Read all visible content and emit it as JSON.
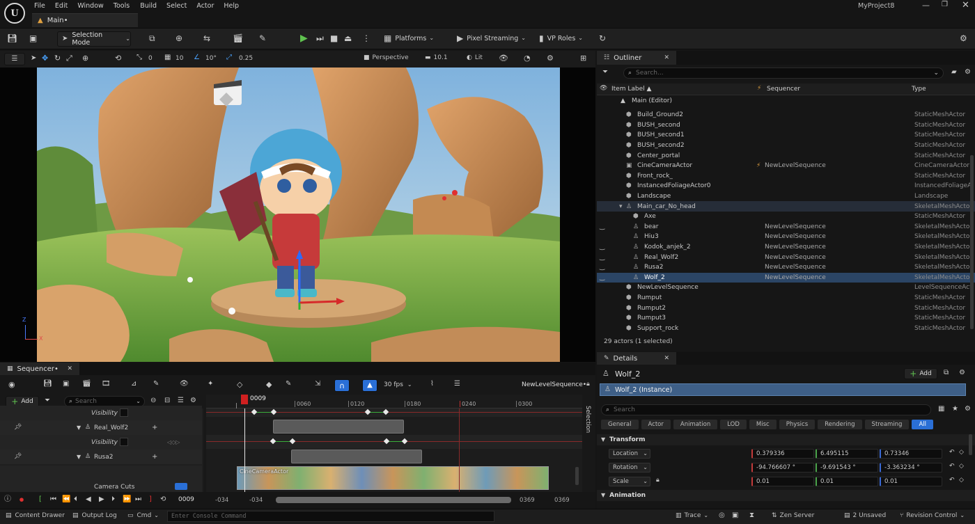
{
  "menubar": {
    "items": [
      "File",
      "Edit",
      "Window",
      "Tools",
      "Build",
      "Select",
      "Actor",
      "Help"
    ],
    "project": "MyProject8",
    "level_tab": "Main•"
  },
  "toolbar": {
    "mode": "Selection Mode",
    "platforms": "Platforms",
    "pixel_streaming": "Pixel Streaming",
    "vp_roles": "VP Roles"
  },
  "viewport_toolbar": {
    "rot_snap": "0",
    "grid": "10",
    "angle": "10°",
    "scale": "0.25",
    "perspective": "Perspective",
    "camera_speed": "10.1",
    "lit": "Lit"
  },
  "axis": {
    "z": "Z",
    "x": "X"
  },
  "outliner": {
    "title": "Outliner",
    "search_placeholder": "Search...",
    "col_label": "Item Label ▲",
    "col_sequencer": "Sequencer",
    "col_type": "Type",
    "root": "Main (Editor)",
    "rows": [
      {
        "label": "Build_Ground2",
        "seq": "",
        "type": "StaticMeshActor",
        "indent": 1,
        "eye": false,
        "sel": false
      },
      {
        "label": "BUSH_second",
        "seq": "",
        "type": "StaticMeshActor",
        "indent": 1,
        "eye": false,
        "sel": false
      },
      {
        "label": "BUSH_second1",
        "seq": "",
        "type": "StaticMeshActor",
        "indent": 1,
        "eye": false,
        "sel": false
      },
      {
        "label": "BUSH_second2",
        "seq": "",
        "type": "StaticMeshActor",
        "indent": 1,
        "eye": false,
        "sel": false
      },
      {
        "label": "Center_portal",
        "seq": "",
        "type": "StaticMeshActor",
        "indent": 1,
        "eye": false,
        "sel": false
      },
      {
        "label": "CineCameraActor",
        "seq": "NewLevelSequence",
        "type": "CineCameraActor",
        "indent": 1,
        "eye": false,
        "sel": false,
        "bolt": true
      },
      {
        "label": "Front_rock_",
        "seq": "",
        "type": "StaticMeshActor",
        "indent": 1,
        "eye": false,
        "sel": false
      },
      {
        "label": "InstancedFoliageActor0",
        "seq": "",
        "type": "InstancedFoliageActor",
        "indent": 1,
        "eye": false,
        "sel": false
      },
      {
        "label": "Landscape",
        "seq": "",
        "type": "Landscape",
        "indent": 1,
        "eye": false,
        "sel": false
      },
      {
        "label": "Main_car_No_head",
        "seq": "",
        "type": "SkeletalMeshActor",
        "indent": 1,
        "eye": false,
        "sel": false,
        "expanded": true,
        "hl": true
      },
      {
        "label": "Axe",
        "seq": "",
        "type": "StaticMeshActor",
        "indent": 2,
        "eye": false,
        "sel": false
      },
      {
        "label": "bear",
        "seq": "NewLevelSequence",
        "type": "SkeletalMeshActor",
        "indent": 2,
        "eye": true,
        "sel": false
      },
      {
        "label": "Hiu3",
        "seq": "NewLevelSequence",
        "type": "SkeletalMeshActor",
        "indent": 2,
        "eye": false,
        "sel": false
      },
      {
        "label": "Kodok_anjek_2",
        "seq": "NewLevelSequence",
        "type": "SkeletalMeshActor",
        "indent": 2,
        "eye": true,
        "sel": false
      },
      {
        "label": "Real_Wolf2",
        "seq": "NewLevelSequence",
        "type": "SkeletalMeshActor",
        "indent": 2,
        "eye": true,
        "sel": false
      },
      {
        "label": "Rusa2",
        "seq": "NewLevelSequence",
        "type": "SkeletalMeshActor",
        "indent": 2,
        "eye": true,
        "sel": false
      },
      {
        "label": "Wolf_2",
        "seq": "NewLevelSequence",
        "type": "SkeletalMeshActor",
        "indent": 2,
        "eye": true,
        "sel": true
      },
      {
        "label": "NewLevelSequence",
        "seq": "",
        "type": "LevelSequenceActor",
        "indent": 1,
        "eye": false,
        "sel": false
      },
      {
        "label": "Rumput",
        "seq": "",
        "type": "StaticMeshActor",
        "indent": 1,
        "eye": false,
        "sel": false
      },
      {
        "label": "Rumput2",
        "seq": "",
        "type": "StaticMeshActor",
        "indent": 1,
        "eye": false,
        "sel": false
      },
      {
        "label": "Rumput3",
        "seq": "",
        "type": "StaticMeshActor",
        "indent": 1,
        "eye": false,
        "sel": false
      },
      {
        "label": "Support_rock",
        "seq": "",
        "type": "StaticMeshActor",
        "indent": 1,
        "eye": false,
        "sel": false
      }
    ],
    "footer": "29 actors (1 selected)"
  },
  "details": {
    "title": "Details",
    "actor": "Wolf_2",
    "add": "Add",
    "instance": "Wolf_2 (Instance)",
    "search_placeholder": "Search",
    "tabs": [
      "General",
      "Actor",
      "Animation",
      "LOD",
      "Misc",
      "Physics",
      "Rendering",
      "Streaming",
      "All"
    ],
    "transform_label": "Transform",
    "location_label": "Location",
    "rotation_label": "Rotation",
    "scale_label": "Scale",
    "location": [
      "0.379336",
      "6.495115",
      "0.73346"
    ],
    "rotation": [
      "-94.766607 °",
      "-9.691543 °",
      "-3.363234 °"
    ],
    "scale": [
      "0.01",
      "0.01",
      "0.01"
    ],
    "animation_label": "Animation"
  },
  "sequencer": {
    "title": "Sequencer•",
    "fps": "30 fps",
    "sequence_name": "NewLevelSequence•",
    "add": "Add",
    "search_placeholder": "Search",
    "current_frame": "0009",
    "ticks": [
      "0060",
      "0120",
      "0180",
      "0240",
      "0300"
    ],
    "tracks": [
      "Visibility",
      "Real_Wolf2",
      "Visibility",
      "Rusa2",
      "Camera Cuts"
    ],
    "camera_actor": "CineCameraActor",
    "selection_label": "Selection",
    "bottom_frame": "0009",
    "range_start_a": "-034",
    "range_start_b": "-034",
    "range_end_a": "0369",
    "range_end_b": "0369"
  },
  "statusbar": {
    "content_drawer": "Content Drawer",
    "output_log": "Output Log",
    "cmd": "Cmd",
    "console_placeholder": "Enter Console Command",
    "trace": "Trace",
    "zen": "Zen Server",
    "unsaved": "2 Unsaved",
    "revision": "Revision Control"
  }
}
